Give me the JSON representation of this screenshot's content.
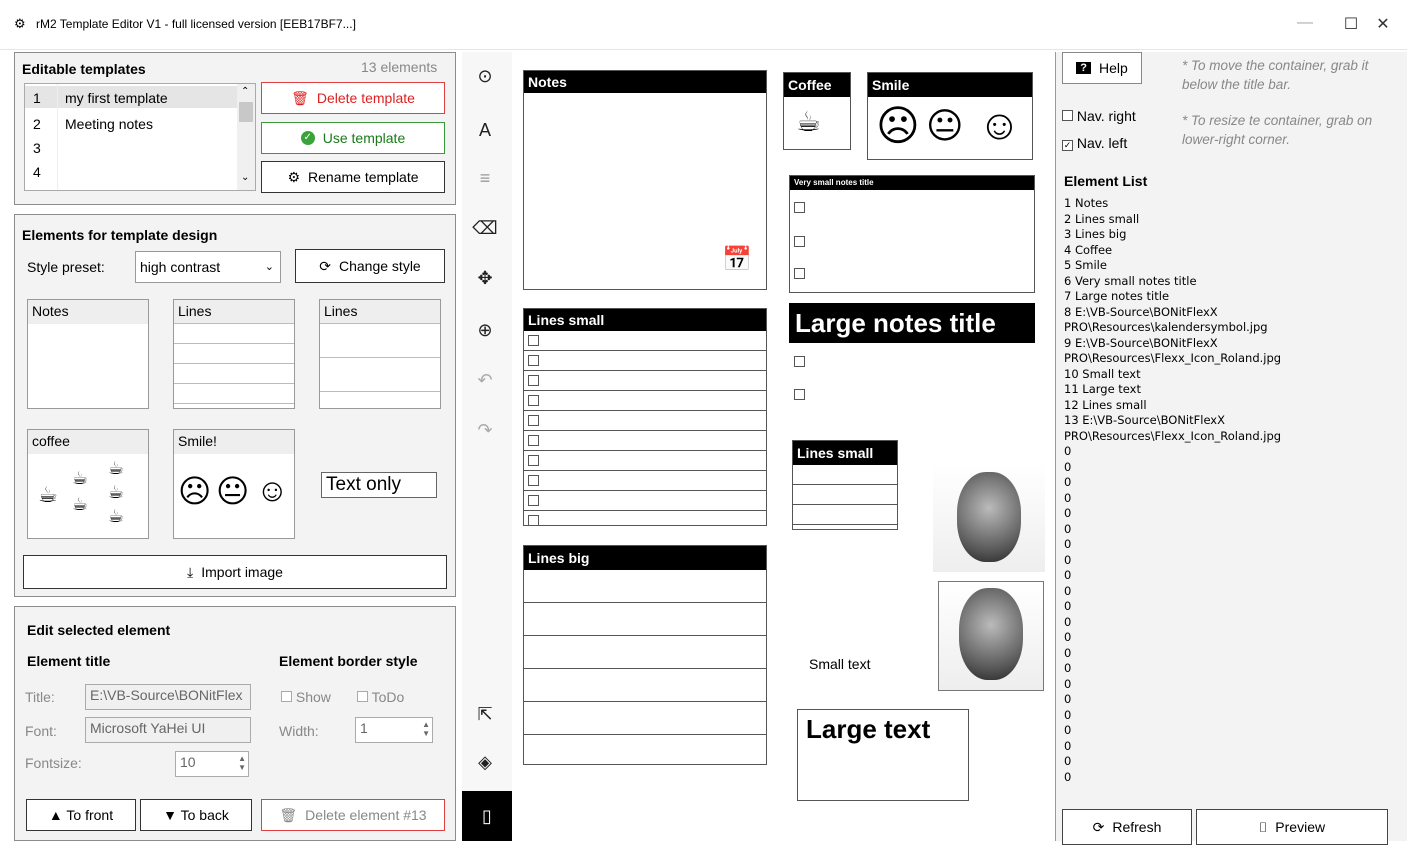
{
  "window": {
    "title": "rM2 Template Editor V1 - full licensed version [EEB17BF7...]"
  },
  "templates": {
    "header": "Editable templates",
    "count": "13 elements",
    "rows": [
      {
        "n": "1",
        "name": "my first template"
      },
      {
        "n": "2",
        "name": "Meeting notes"
      },
      {
        "n": "3",
        "name": ""
      },
      {
        "n": "4",
        "name": ""
      }
    ],
    "delete": "Delete template",
    "use": "Use template",
    "rename": "Rename template"
  },
  "design": {
    "header": "Elements for template design",
    "style_label": "Style preset:",
    "style_value": "high contrast",
    "change": "Change style",
    "items": [
      "Notes",
      "Lines",
      "Lines",
      "coffee",
      "Smile!",
      "Text only"
    ],
    "import": "Import image"
  },
  "edit": {
    "header": "Edit selected element",
    "title_h": "Element title",
    "border_h": "Element border style",
    "title_l": "Title:",
    "title_v": "E:\\VB-Source\\BONitFlex",
    "font_l": "Font:",
    "font_v": "Microsoft YaHei UI",
    "size_l": "Fontsize:",
    "size_v": "10",
    "show": "Show",
    "todo": "ToDo",
    "width_l": "Width:",
    "width_v": "1",
    "front": "▲ To front",
    "back": "▼ To back",
    "delete": "Delete element #13"
  },
  "canvas": {
    "notes": "Notes",
    "coffee": "Coffee",
    "smile": "Smile",
    "vsmall": "Very small notes title",
    "large": "Large notes title",
    "lines_small": "Lines small",
    "lines_big": "Lines big",
    "lines_small2": "Lines small",
    "small_text": "Small text",
    "large_text": "Large text"
  },
  "right": {
    "help": "Help",
    "hint1": "* To move the container, grab it below the title bar.",
    "hint2": "* To resize te container, grab on lower-right corner.",
    "nav_right": "Nav. right",
    "nav_left": "Nav. left",
    "list_header": "Element List",
    "list": [
      "1 Notes",
      "2 Lines small",
      "3 Lines big",
      "4 Coffee",
      "5 Smile",
      "6 Very small notes title",
      "7 Large notes title",
      "8 E:\\VB-Source\\BONitFlexX",
      "PRO\\Resources\\kalendersymbol.jpg",
      "9 E:\\VB-Source\\BONitFlexX",
      "PRO\\Resources\\Flexx_Icon_Roland.jpg",
      "10 Small text",
      "11 Large text",
      "12 Lines small",
      "13 E:\\VB-Source\\BONitFlexX",
      "PRO\\Resources\\Flexx_Icon_Roland.jpg",
      "0",
      "0",
      "0",
      "0",
      "0",
      "0",
      "0",
      "0",
      "0",
      "0",
      "0",
      "0",
      "0",
      "0",
      "0",
      "0",
      "0",
      "0",
      "0",
      "0",
      "0",
      "0"
    ],
    "refresh": "Refresh",
    "preview": "Preview"
  }
}
